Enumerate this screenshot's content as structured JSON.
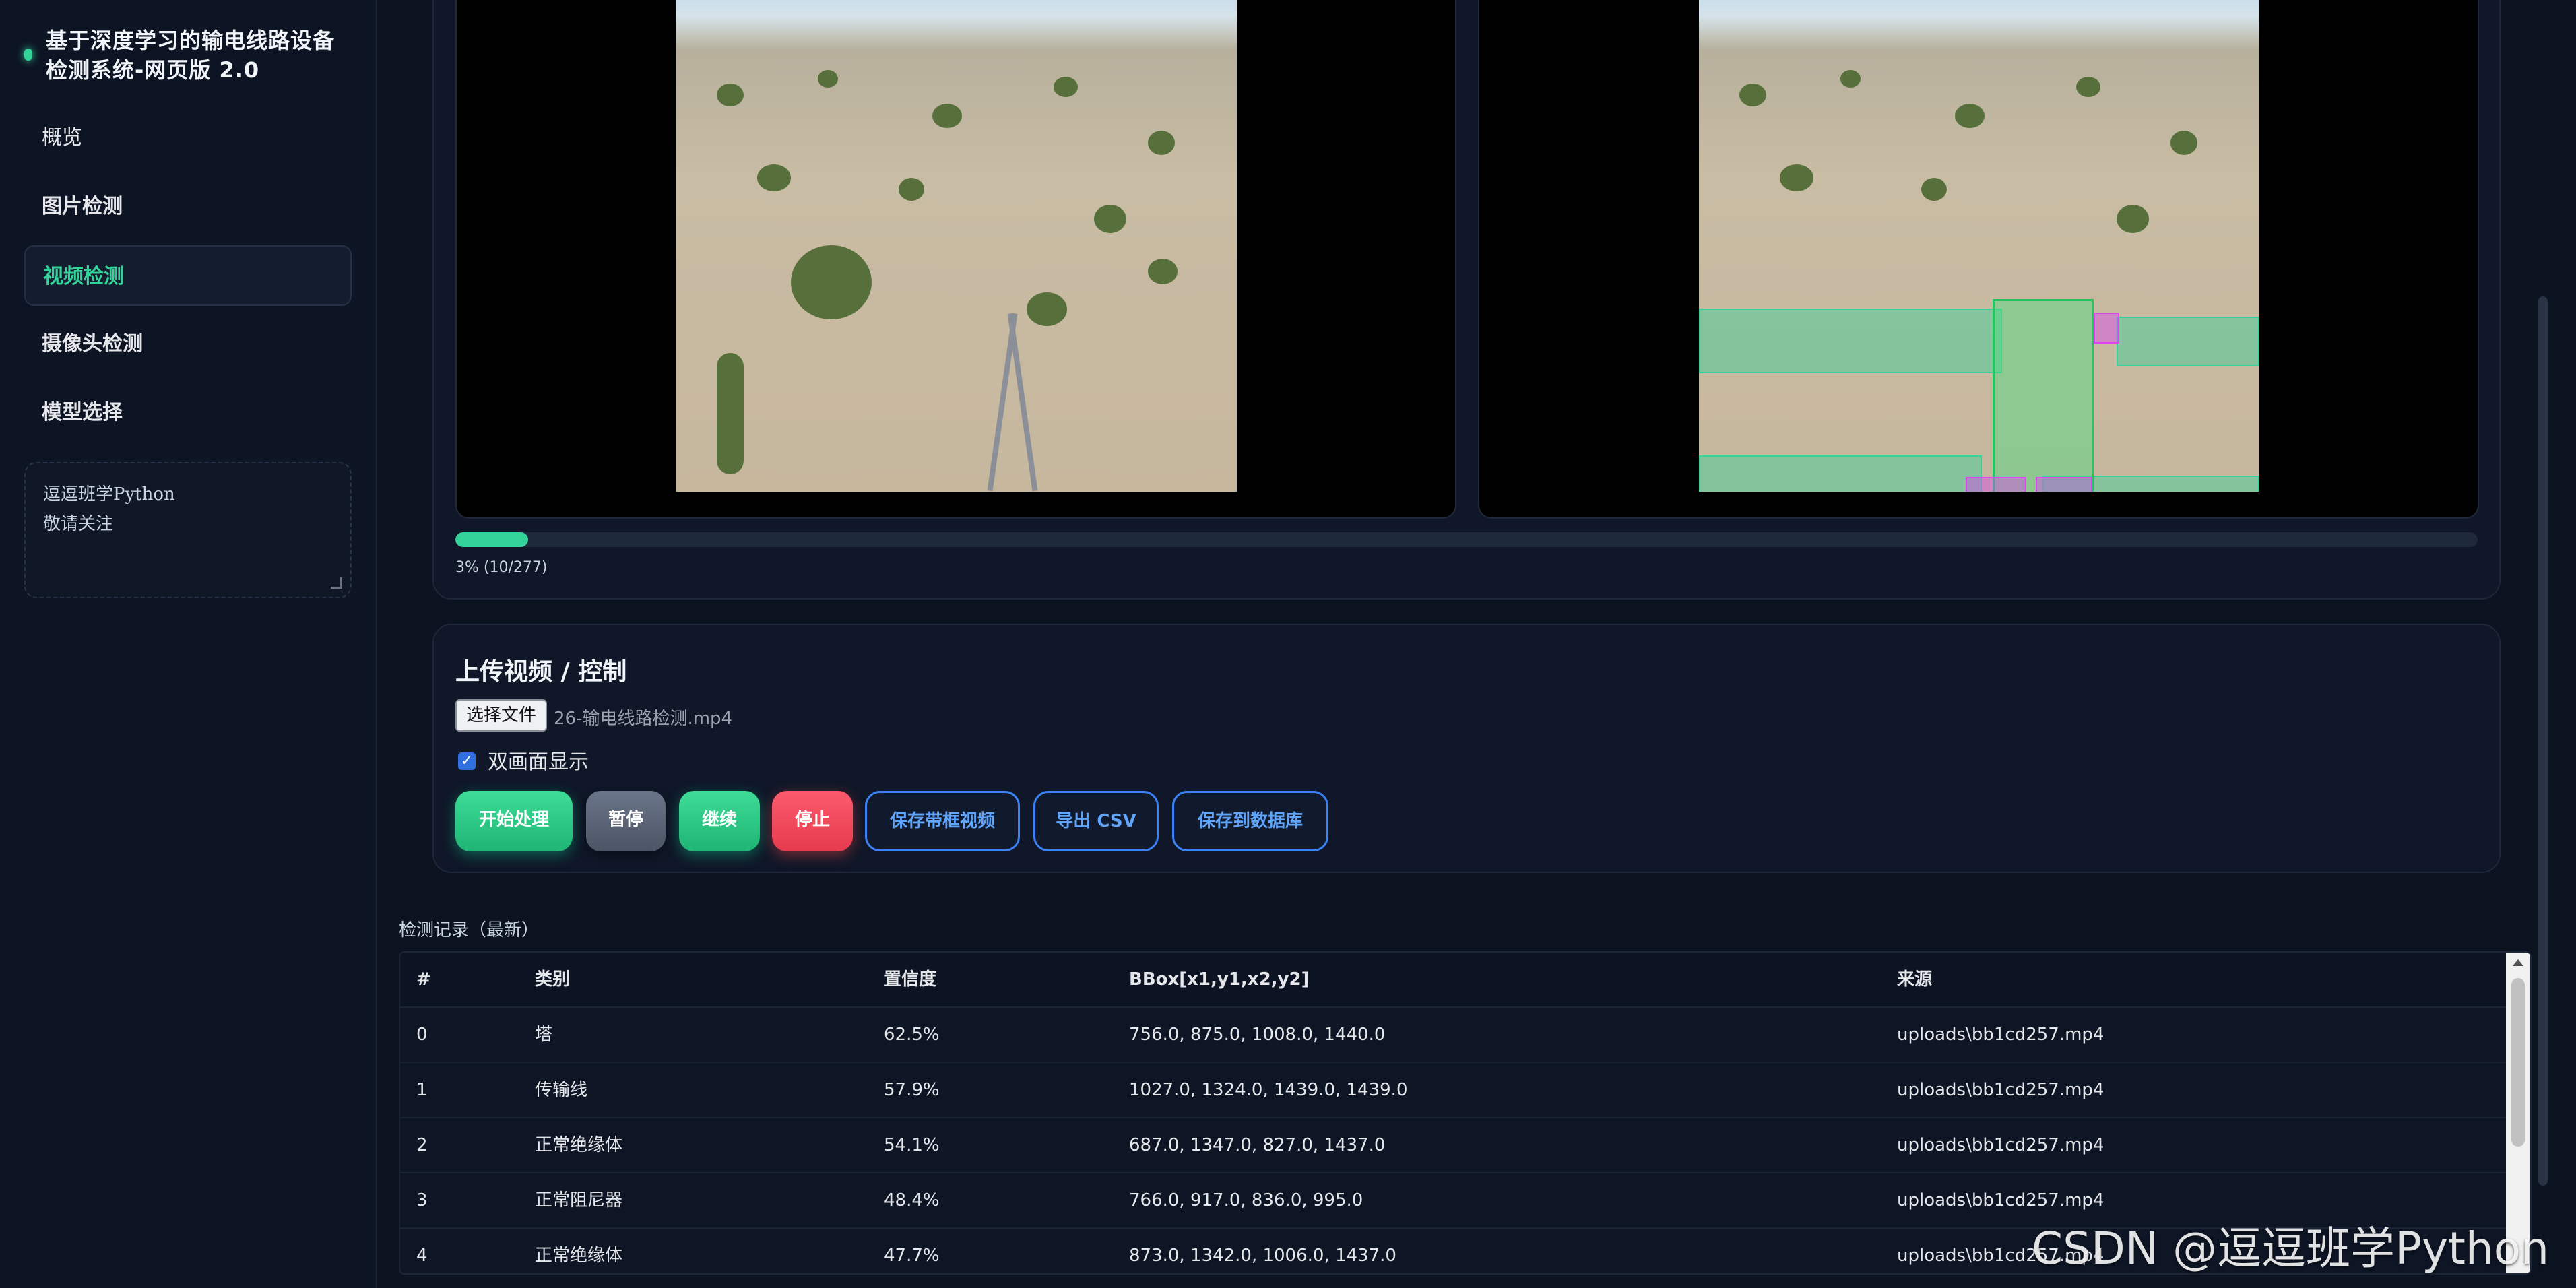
{
  "sidebar": {
    "title": "基于深度学习的输电线路设备检测系统-网页版 2.0",
    "items": [
      {
        "label": "概览",
        "active": false
      },
      {
        "label": "图片检测",
        "active": false
      },
      {
        "label": "视频检测",
        "active": true
      },
      {
        "label": "摄像头检测",
        "active": false
      },
      {
        "label": "模型选择",
        "active": false
      }
    ],
    "note_text": "逗逗班学Python\n敬请关注"
  },
  "progress": {
    "value": 0.036,
    "text": "3% (10/277)"
  },
  "control": {
    "title": "上传视频 / 控制",
    "file_button": "选择文件",
    "file_name": "26-输电线路检测.mp4",
    "dual_view_label": "双画面显示",
    "dual_view_checked": true,
    "buttons": {
      "start": "开始处理",
      "pause": "暂停",
      "resume": "继续",
      "stop": "停止",
      "save_video": "保存带框视频",
      "export_csv": "导出 CSV",
      "save_db": "保存到数据库"
    }
  },
  "records": {
    "title": "检测记录（最新）",
    "columns": [
      "#",
      "类别",
      "置信度",
      "BBox[x1,y1,x2,y2]",
      "来源"
    ],
    "rows": [
      [
        "0",
        "塔",
        "62.5%",
        "756.0, 875.0, 1008.0, 1440.0",
        "uploads\\bb1cd257.mp4"
      ],
      [
        "1",
        "传输线",
        "57.9%",
        "1027.0, 1324.0, 1439.0, 1439.0",
        "uploads\\bb1cd257.mp4"
      ],
      [
        "2",
        "正常绝缘体",
        "54.1%",
        "687.0, 1347.0, 827.0, 1437.0",
        "uploads\\bb1cd257.mp4"
      ],
      [
        "3",
        "正常阻尼器",
        "48.4%",
        "766.0, 917.0, 836.0, 995.0",
        "uploads\\bb1cd257.mp4"
      ],
      [
        "4",
        "正常绝缘体",
        "47.7%",
        "873.0, 1342.0, 1006.0, 1437.0",
        "uploads\\bb1cd257.mp4"
      ]
    ]
  },
  "watermark": "CSDN @逗逗班学Python",
  "colors": {
    "accent": "#34d399",
    "danger": "#ef4444",
    "link": "#60a5fa",
    "background": "#0b1220"
  }
}
